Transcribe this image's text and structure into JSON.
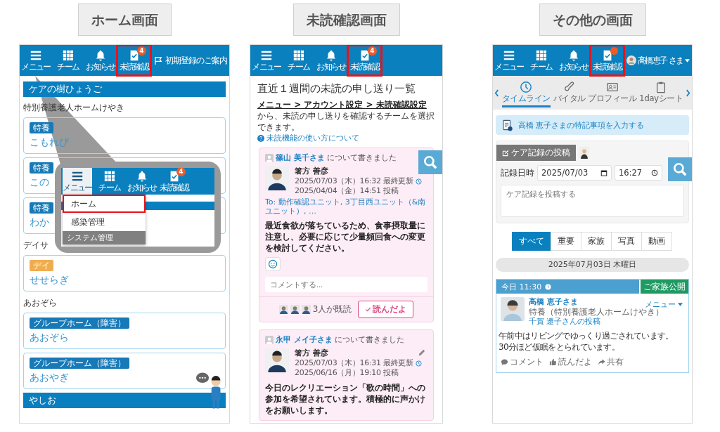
{
  "home": {
    "caption": "ホーム画面",
    "nav": [
      {
        "label": "メニュー",
        "kind": "menu",
        "highlighted": false
      },
      {
        "label": "チーム",
        "kind": "grid",
        "highlighted": false
      },
      {
        "label": "お知らせ",
        "kind": "bell",
        "highlighted": false
      },
      {
        "label": "未読確認",
        "kind": "check",
        "badge": "4",
        "highlighted": true
      }
    ],
    "guide": "初期登録のご案内",
    "items": [
      {
        "kind": "header",
        "text": "ケアの樹ひょうご"
      },
      {
        "kind": "label",
        "text": "特別養護老人ホームけやき"
      },
      {
        "kind": "card",
        "tag": "特養",
        "color": "#1679b8",
        "name": "こもれび"
      },
      {
        "kind": "card",
        "tag": "特養",
        "color": "#1679b8",
        "name": "この"
      },
      {
        "kind": "card",
        "tag": "特養",
        "color": "#1679b8",
        "name": "わか"
      },
      {
        "kind": "label",
        "text": "デイサ"
      },
      {
        "kind": "card",
        "tag": "デイ",
        "color": "#f0ad4e",
        "name": "せせらぎ"
      },
      {
        "kind": "label",
        "text": "あおぞら"
      },
      {
        "kind": "card",
        "tag": "グループホーム（障害）",
        "color": "#1679b8",
        "name": "あおぞら"
      },
      {
        "kind": "card",
        "tag": "グループホーム（障害）",
        "color": "#1679b8",
        "name": "あおやぎ"
      },
      {
        "kind": "header",
        "text": "やしお"
      }
    ],
    "popup": {
      "nav": [
        {
          "label": "メニュー",
          "kind": "menu",
          "selected": true
        },
        {
          "label": "チーム",
          "kind": "grid",
          "selected": false
        },
        {
          "label": "お知らせ",
          "kind": "bell",
          "selected": false
        },
        {
          "label": "未読確認",
          "kind": "check",
          "badge": "4",
          "selected": false
        }
      ],
      "menu": [
        {
          "kind": "item",
          "label": "ホーム",
          "highlighted": true
        },
        {
          "kind": "item",
          "label": "感染管理",
          "highlighted": false
        },
        {
          "kind": "section",
          "label": "システム管理"
        }
      ]
    }
  },
  "unread": {
    "caption": "未読確認画面",
    "nav": [
      {
        "label": "メニュー",
        "kind": "menu",
        "highlighted": false
      },
      {
        "label": "チーム",
        "kind": "grid",
        "highlighted": false
      },
      {
        "label": "お知らせ",
        "kind": "bell",
        "highlighted": false
      },
      {
        "label": "未読確認",
        "kind": "check",
        "badge": "4",
        "highlighted": true
      }
    ],
    "title": "直近１週間の未読の申し送り一覧",
    "intro": {
      "link": "メニュー > アカウント設定 > 未読確認設定",
      "text": " から、未読の申し送りを確認するチームを選択できます。"
    },
    "help": "未読機能の使い方について",
    "posts": [
      {
        "resident": "篠山 美千さま",
        "suffix": "について書きました",
        "author": "箸方 善彦",
        "updated": "2025/07/03（木）16:32 最終更新",
        "posted": "2025/04/04（金）14:51 投稿",
        "to": "To: 動作確認ユニット, 3丁目西ユニット（&南ユニット）, …",
        "body": "最近食欲が落ちているため、食事摂取量に注意し、必要に応じて少量頻回食への変更を検討してください。",
        "editable": false,
        "comment_placeholder": "コメントする...",
        "readers": "3人が既読",
        "read_button": "読んだよ"
      },
      {
        "resident": "永甲 メイ子さま",
        "suffix": "について書きました",
        "author": "箸方 善彦",
        "updated": "2025/07/03（木）16:31 最終更新",
        "posted": "2025/06/16（月）19:10 投稿",
        "body": "今日のレクリエーション「歌の時間」への参加を希望されています。積極的に声かけをお願いします。",
        "editable": true
      }
    ]
  },
  "other": {
    "caption": "その他の画面",
    "nav": [
      {
        "label": "メニュー",
        "kind": "menu",
        "highlighted": false,
        "alert": false
      },
      {
        "label": "チーム",
        "kind": "grid",
        "highlighted": false,
        "alert": false
      },
      {
        "label": "お知らせ",
        "kind": "bell",
        "highlighted": false,
        "alert": false
      },
      {
        "label": "未読確認",
        "kind": "check",
        "highlighted": true,
        "alert": true
      }
    ],
    "user": "高橋恵子 さま",
    "tabs": [
      {
        "label": "タイムライン",
        "kind": "clock",
        "selected": true
      },
      {
        "label": "バイタル",
        "kind": "thermometer",
        "selected": false
      },
      {
        "label": "プロフィール",
        "kind": "card",
        "selected": false
      },
      {
        "label": "1dayシート",
        "kind": "clipboard",
        "selected": false
      }
    ],
    "notice": "高橋 恵子さまの特記事項を入力する",
    "compose": {
      "button": "ケア記録の投稿",
      "date_label": "記録日時",
      "date": "2025/07/03",
      "time": "16:27",
      "placeholder": "ケア記録を投稿する"
    },
    "filters": [
      {
        "label": "すべて",
        "selected": true
      },
      {
        "label": "重要",
        "selected": false
      },
      {
        "label": "家族",
        "selected": false
      },
      {
        "label": "写真",
        "selected": false
      },
      {
        "label": "動画",
        "selected": false
      }
    ],
    "date_header": "2025年07月03日 木曜日",
    "entry": {
      "time": "今日 11:30",
      "visibility": "ご家族公開",
      "name": "高橋 恵子さま",
      "facility": "特養（特別養護老人ホームけやき）",
      "poster": "千賀 遼子さんの投稿",
      "menu": "メニュー",
      "body": [
        "午前中はリビングでゆっくり過ごされています。",
        "30分ほど仮眠をとられています。"
      ],
      "actions": [
        {
          "kind": "comment",
          "label": "コメント"
        },
        {
          "kind": "like",
          "label": "読んだよ"
        },
        {
          "kind": "share",
          "label": "共有"
        }
      ]
    }
  }
}
